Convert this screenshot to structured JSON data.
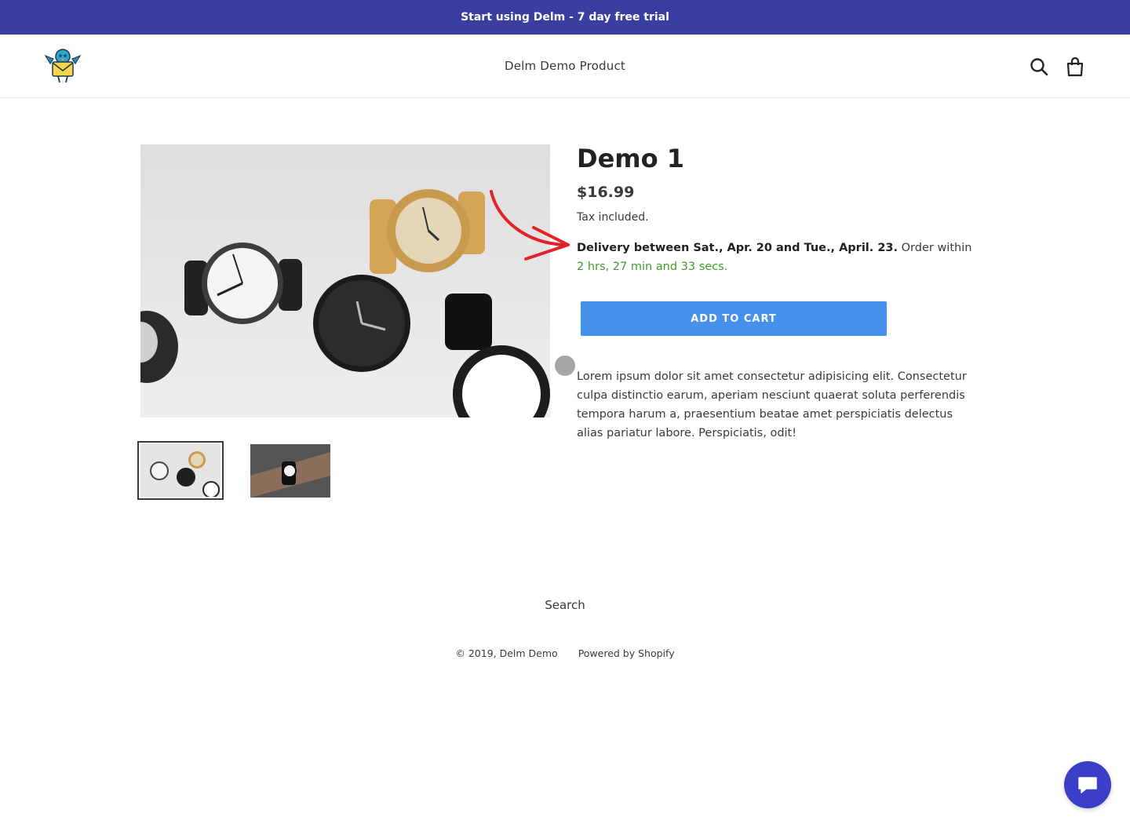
{
  "announcement": {
    "text": "Start using Delm - 7 day free trial"
  },
  "header": {
    "logo_icon": "bird-with-envelope-logo",
    "store_name": "Delm Demo Product",
    "search_icon": "search-icon",
    "cart_icon": "shopping-bag-icon"
  },
  "product": {
    "title": "Demo 1",
    "price": "$16.99",
    "tax_note": "Tax included.",
    "delivery_bold": "Delivery between Sat., Apr. 20 and Tue., April. 23.",
    "delivery_order": "Order within",
    "delivery_countdown": "2 hrs, 27 min and 33 secs.",
    "add_to_cart_label": "ADD TO CART",
    "description": "Lorem ipsum dolor sit amet consectetur adipisicing elit. Consectetur culpa distinctio earum, aperiam nesciunt quaerat soluta perferendis tempora harum a, praesentium beatae amet perspiciatis delectus alias pariatur labore. Perspiciatis, odit!",
    "images": [
      "watches-on-table-photo",
      "watch-on-wrist-photo"
    ]
  },
  "footer": {
    "search_link": "Search",
    "copyright": "© 2019, Delm Demo",
    "powered_by": "Powered by Shopify"
  },
  "colors": {
    "announcement_bg": "#3a3ea0",
    "button_bg": "#4591eb",
    "countdown": "#3f9d2a",
    "annotation_arrow": "#e2232a",
    "chat_button_bg": "#3b3ec8"
  },
  "chat": {
    "icon": "chat-bubble-icon"
  }
}
